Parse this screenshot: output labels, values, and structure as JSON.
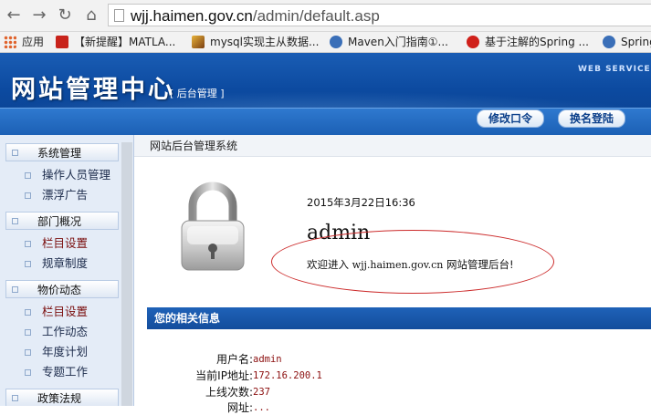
{
  "browser": {
    "url_host": "wjj.haimen.gov.cn",
    "url_path": "/admin/default.asp",
    "bookmarks": [
      {
        "label": "应用",
        "icon": "apps-icon",
        "color": "#e0622b"
      },
      {
        "label": "【新提醒】MATLA...",
        "icon": "bookmark-red-icon",
        "color": "#c8231b"
      },
      {
        "label": "mysql实现主从数据...",
        "icon": "mysql-icon",
        "color": "#b07a1a"
      },
      {
        "label": "Maven入门指南①...",
        "icon": "maven-icon",
        "color": "#3a6fb8"
      },
      {
        "label": "基于注解的Spring ...",
        "icon": "csdn-icon",
        "color": "#d0201a"
      },
      {
        "label": "Spring",
        "icon": "spring-icon",
        "color": "#3a6fb8"
      }
    ]
  },
  "header": {
    "title": "网站管理中心",
    "subtitle": "[ 后台管理 ]",
    "tag": "WEB SERVICE",
    "change_password": "修改口令",
    "switch_login": "换名登陆",
    "colors": {
      "top": "#1a5db4",
      "bottom": "#0a3f8c"
    }
  },
  "sidebar": {
    "sections": [
      {
        "label": "系统管理",
        "items": [
          "操作人员管理",
          "漂浮广告"
        ]
      },
      {
        "label": "部门概况",
        "items": [
          "栏目设置",
          "规章制度"
        ]
      },
      {
        "label": "物价动态",
        "items": [
          "栏目设置",
          "工作动态",
          "年度计划",
          "专题工作"
        ]
      },
      {
        "label": "政策法规",
        "items": []
      }
    ]
  },
  "main": {
    "breadcrumb": "网站后台管理系统",
    "datetime": "2015年3月22日16:36",
    "username": "admin",
    "welcome_prefix": "欢迎进入",
    "welcome_site": "wjj.haimen.gov.cn",
    "welcome_suffix": "网站管理后台!",
    "info_title": "您的相关信息",
    "info": [
      {
        "label": "用户名:",
        "value": "admin"
      },
      {
        "label": "当前IP地址:",
        "value": "172.16.200.1"
      },
      {
        "label": "上线次数:",
        "value": "237"
      },
      {
        "label": "网址:",
        "value": "..."
      }
    ]
  }
}
